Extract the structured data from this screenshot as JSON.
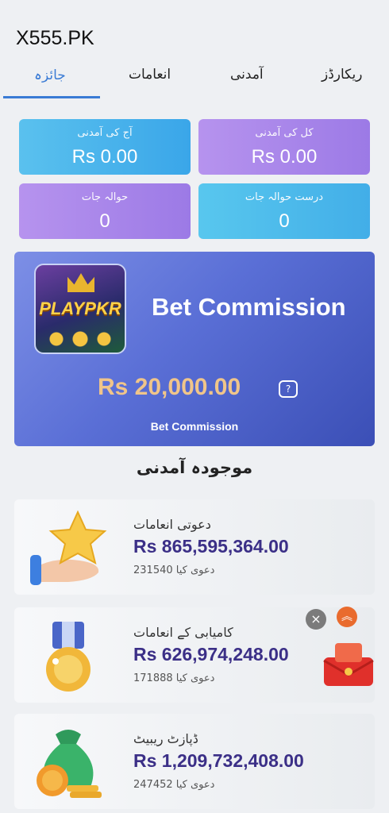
{
  "app": {
    "title": "X555.PK"
  },
  "tabs": [
    {
      "label": "جائزہ"
    },
    {
      "label": "انعامات"
    },
    {
      "label": "آمدنی"
    },
    {
      "label": "ریکارڈز"
    }
  ],
  "stats": {
    "today_income": {
      "label": "آج کی آمدنی",
      "value": "Rs 0.00"
    },
    "total_income": {
      "label": "کل کی آمدنی",
      "value": "Rs 0.00"
    },
    "referrals": {
      "label": "حوالہ جات",
      "value": "0"
    },
    "valid_referrals": {
      "label": "درست حوالہ جات",
      "value": "0"
    }
  },
  "promo": {
    "logo_text": "PLAYPKR",
    "title": "Bet Commission",
    "amount": "Rs 20,000.00",
    "help_icon": "?",
    "subtitle": "Bet Commission"
  },
  "section": {
    "title": "موجودہ آمدنی"
  },
  "cards": [
    {
      "title": "دعوتی انعامات",
      "amount": "Rs 865,595,364.00",
      "claimed_value": "231540",
      "claimed_label": "دعوی کیا",
      "icon": "star-hand-icon"
    },
    {
      "title": "کامیابی کے انعامات",
      "amount": "Rs 626,974,248.00",
      "claimed_value": "171888",
      "claimed_label": "دعوی کیا",
      "icon": "medal-icon"
    },
    {
      "title": "ڈپازٹ ریبیٹ",
      "amount": "Rs 1,209,732,408.00",
      "claimed_value": "247452",
      "claimed_label": "دعوی کیا",
      "icon": "money-bag-icon"
    }
  ],
  "floating": {
    "close": "×",
    "up": "︽",
    "gift_icon": "red-envelope-icon"
  },
  "colors": {
    "accent": "#3a7bd5",
    "amount": "#3b2f87",
    "promo_amount": "#f0c58a"
  }
}
